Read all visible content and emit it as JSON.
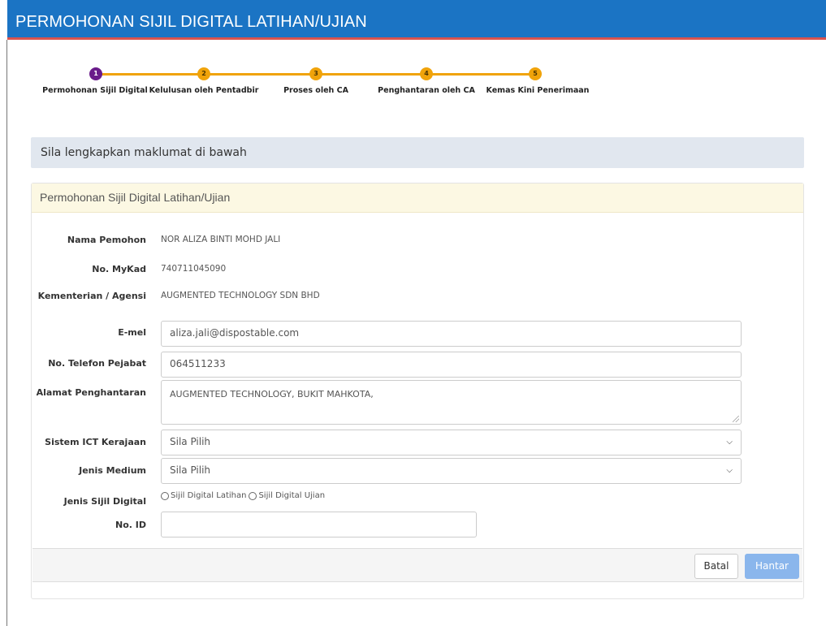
{
  "header": {
    "title": "PERMOHONAN SIJIL DIGITAL LATIHAN/UJIAN"
  },
  "stepper": {
    "steps": [
      {
        "number": "1",
        "label": "Permohonan Sijil Digital"
      },
      {
        "number": "2",
        "label": "Kelulusan oleh Pentadbir"
      },
      {
        "number": "3",
        "label": "Proses oleh CA"
      },
      {
        "number": "4",
        "label": "Penghantaran oleh CA"
      },
      {
        "number": "5",
        "label": "Kemas Kini Penerimaan"
      }
    ],
    "active_step": 1
  },
  "notice": {
    "text": "Sila lengkapkan maklumat di bawah"
  },
  "panel": {
    "heading": "Permohonan Sijil Digital Latihan/Ujian"
  },
  "form": {
    "nama": {
      "label": "Nama Pemohon",
      "value": "NOR ALIZA BINTI MOHD JALI"
    },
    "mykad": {
      "label": "No. MyKad",
      "value": "740711045090"
    },
    "agensi": {
      "label": "Kementerian / Agensi",
      "value": "AUGMENTED TECHNOLOGY SDN BHD"
    },
    "email": {
      "label": "E-mel",
      "value": "aliza.jali@dispostable.com"
    },
    "telefon": {
      "label": "No. Telefon Pejabat",
      "value": "064511233"
    },
    "alamat": {
      "label": "Alamat Penghantaran",
      "value": "AUGMENTED TECHNOLOGY, BUKIT MAHKOTA,"
    },
    "sistem_ict": {
      "label": "Sistem ICT Kerajaan",
      "value": "Sila Pilih"
    },
    "jenis_medium": {
      "label": "Jenis Medium",
      "value": "Sila Pilih"
    },
    "jenis_sijil": {
      "label": "Jenis Sijil Digital",
      "options": [
        "Sijil Digital Latihan",
        "Sijil Digital Ujian"
      ]
    },
    "no_id": {
      "label": "No. ID",
      "value": ""
    }
  },
  "buttons": {
    "batal": "Batal",
    "hantar": "Hantar"
  },
  "colors": {
    "header": "#1b74c4",
    "step": "#f0a30a",
    "active_step": "#6a1b8a",
    "submit": "#8ab6ec"
  }
}
